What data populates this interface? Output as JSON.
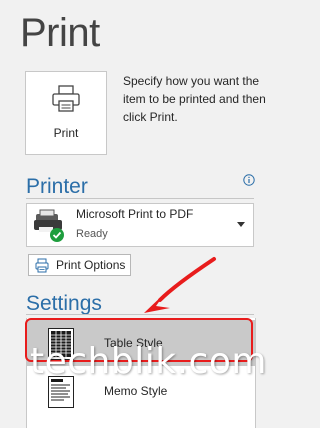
{
  "page": {
    "title": "Print"
  },
  "print_button": {
    "label": "Print",
    "icon": "printer-icon"
  },
  "print_description": "Specify how you want the item to be printed and then click Print.",
  "printer": {
    "heading": "Printer",
    "info_icon": "info-icon",
    "selected": {
      "name": "Microsoft Print to PDF",
      "status": "Ready",
      "icon": "printer-ready-icon"
    },
    "options_button": "Print Options"
  },
  "settings": {
    "heading": "Settings",
    "styles": [
      {
        "label": "Table Style",
        "selected": true,
        "icon": "table-style-icon"
      },
      {
        "label": "Memo Style",
        "selected": false,
        "icon": "memo-style-icon"
      }
    ]
  },
  "annotation": {
    "color": "#e81c1c"
  },
  "watermark": "techblik.com",
  "colors": {
    "accent": "#2b6ea8",
    "background": "#f1f1f1",
    "selected_row": "#c9c9c9"
  }
}
